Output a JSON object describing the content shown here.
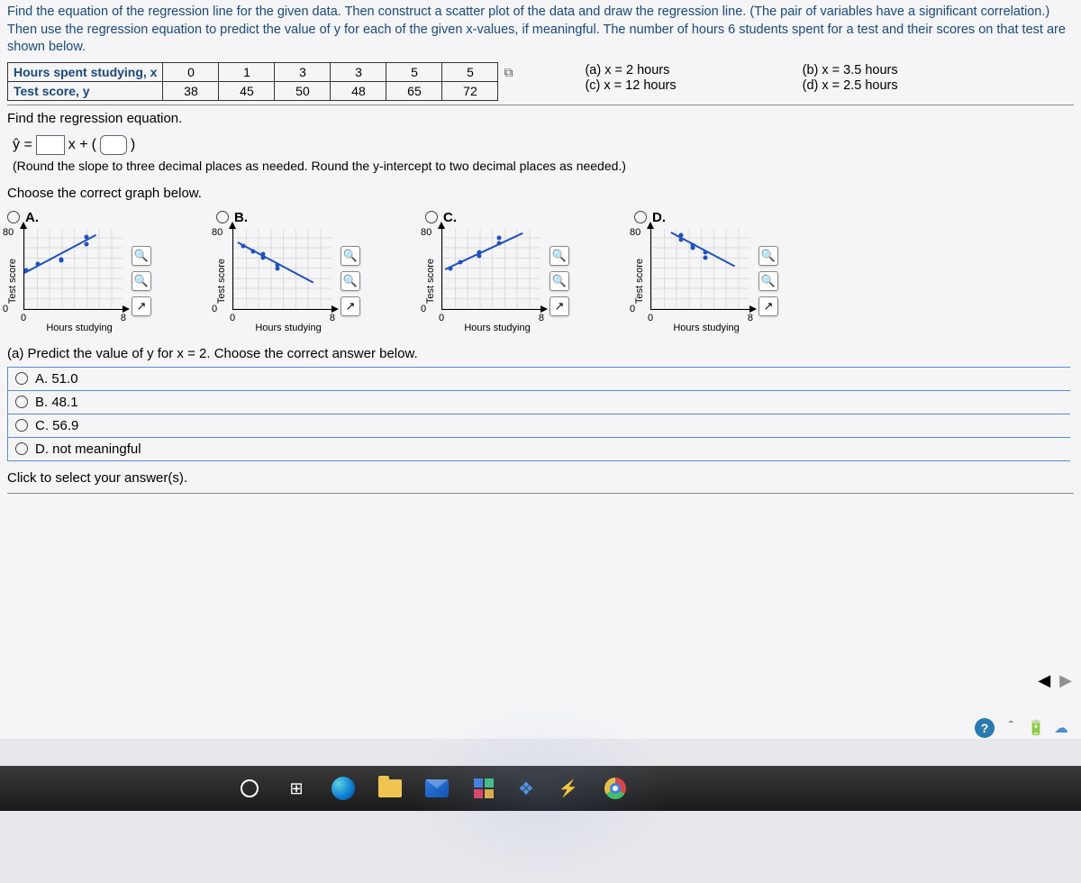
{
  "intro": "Find the equation of the regression line for the given data. Then construct a scatter plot of the data and draw the regression line. (The pair of variables have a significant correlation.) Then use the regression equation to predict the value of y for each of the given x-values, if meaningful. The number of hours 6 students spent for a test and their scores on that test are shown below.",
  "table": {
    "row1_label": "Hours spent studying, x",
    "row2_label": "Test score, y",
    "x": [
      "0",
      "1",
      "3",
      "3",
      "5",
      "5"
    ],
    "y": [
      "38",
      "45",
      "50",
      "48",
      "65",
      "72"
    ]
  },
  "predict": {
    "a": "(a) x = 2 hours",
    "b": "(b) x = 3.5 hours",
    "c": "(c) x = 12 hours",
    "d": "(d) x = 2.5 hours"
  },
  "sections": {
    "find_reg": "Find the regression equation.",
    "eq_prefix": "ŷ =",
    "eq_mid": "x +",
    "round_hint": "(Round the slope to three decimal places as needed. Round the y-intercept to two decimal places as needed.)",
    "choose_graph": "Choose the correct graph below.",
    "part_a": "(a) Predict the value of y for x = 2. Choose the correct answer below.",
    "click_select": "Click to select your answer(s)."
  },
  "graph_labels": {
    "A": "A.",
    "B": "B.",
    "C": "C.",
    "D": "D.",
    "xlab": "Hours studying",
    "ylab": "Test score",
    "xmin": "0",
    "xmax": "8",
    "ymin": "0",
    "ymax": "80"
  },
  "answers": {
    "A": "A.   51.0",
    "B": "B.   48.1",
    "C": "C.   56.9",
    "D": "D.   not meaningful"
  },
  "chart_data": {
    "type": "scatter",
    "title": "",
    "xlabel": "Hours studying",
    "ylabel": "Test score",
    "xlim": [
      0,
      8
    ],
    "ylim": [
      0,
      80
    ],
    "series": [
      {
        "name": "data",
        "x": [
          0,
          1,
          3,
          3,
          5,
          5
        ],
        "y": [
          38,
          45,
          50,
          48,
          65,
          72
        ]
      }
    ],
    "variants": {
      "A": {
        "line_slope_sign": "positive",
        "y_origin": "0",
        "note": "points low-left rising"
      },
      "B": {
        "line_slope_sign": "negative",
        "y_origin": "0"
      },
      "C": {
        "line_slope_sign": "positive",
        "y_origin": "0",
        "note": "points clustered mid-high"
      },
      "D": {
        "line_slope_sign": "negative",
        "y_origin": "0",
        "note": "points near top descending"
      }
    }
  }
}
